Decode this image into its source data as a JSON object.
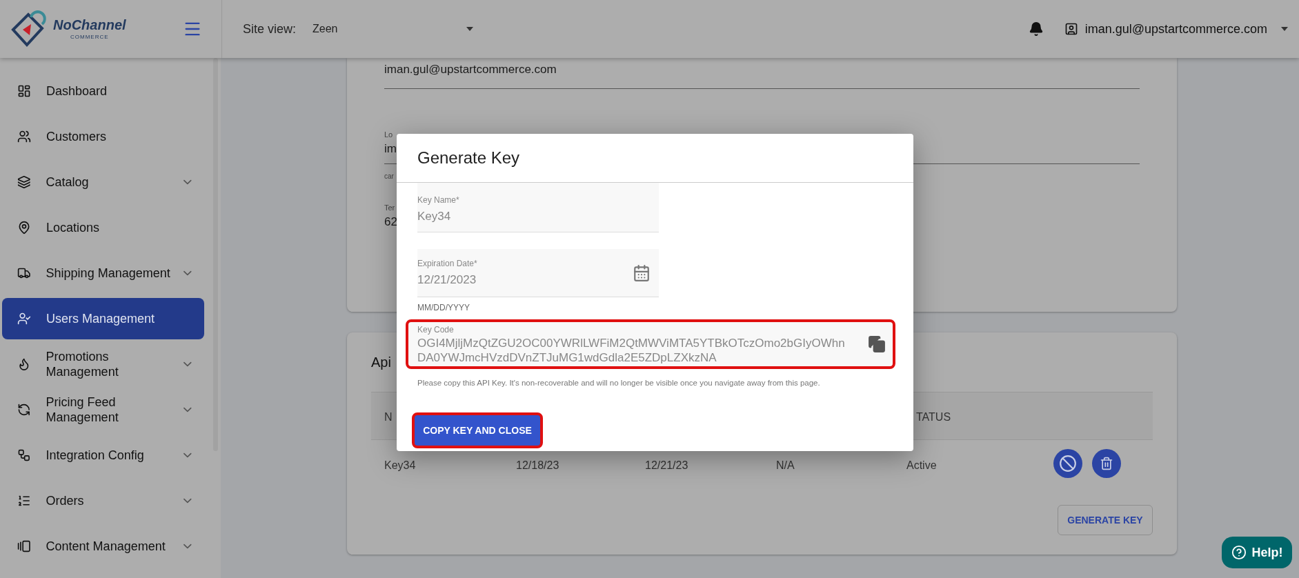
{
  "header": {
    "site_view_label": "Site view:",
    "site_view_value": "Zeen",
    "user_email": "iman.gul@upstartcommerce.com",
    "logo_text": "NoChannel",
    "logo_subtext": "COMMERCE"
  },
  "sidebar": {
    "items": [
      {
        "label": "Dashboard",
        "collapsible": false,
        "selected": false
      },
      {
        "label": "Customers",
        "collapsible": false,
        "selected": false
      },
      {
        "label": "Catalog",
        "collapsible": true,
        "selected": false
      },
      {
        "label": "Locations",
        "collapsible": false,
        "selected": false
      },
      {
        "label": "Shipping Management",
        "collapsible": true,
        "selected": false
      },
      {
        "label": "Users Management",
        "collapsible": false,
        "selected": true
      },
      {
        "label": "Promotions Management",
        "collapsible": true,
        "selected": false
      },
      {
        "label": "Pricing Feed Management",
        "collapsible": true,
        "selected": false
      },
      {
        "label": "Integration Config",
        "collapsible": true,
        "selected": false
      },
      {
        "label": "Orders",
        "collapsible": true,
        "selected": false
      },
      {
        "label": "Content Management",
        "collapsible": true,
        "selected": false
      }
    ]
  },
  "profile_card": {
    "email_value": "iman.gul@upstartcommerce.com",
    "field_2_label": "Lo",
    "field_2_value": "im",
    "field_2_hint": "car",
    "field_3_label": "Ter",
    "field_3_value": "62"
  },
  "api_card": {
    "title": "Api",
    "columns": [
      "N",
      "",
      "",
      "",
      "TATUS"
    ],
    "rows": [
      {
        "cells": [
          "Key34",
          "12/18/23",
          "12/21/23",
          "N/A",
          "Active"
        ]
      }
    ],
    "generate_button": "GENERATE KEY"
  },
  "modal": {
    "title": "Generate Key",
    "key_name": {
      "label": "Key Name*",
      "value": "Key34"
    },
    "expiration": {
      "label": "Expiration Date*",
      "value": "12/21/2023",
      "hint": "MM/DD/YYYY"
    },
    "key_code": {
      "label": "Key Code",
      "value_lines": [
        "OGI4MjljMzQtZGU2OC00YWRlLWFiM2QtMWViMTA5YTBkOTczOmo2bGIyOWhn",
        "DA0YWJmcHVzdDVnZTJuMG1wdGdla2E5ZDpLZXkzNA"
      ]
    },
    "note": "Please copy this API Key. It's non-recoverable and will no longer be visible once you navigate away from this page.",
    "button": "COPY KEY AND CLOSE"
  },
  "help_button": "Help!"
}
